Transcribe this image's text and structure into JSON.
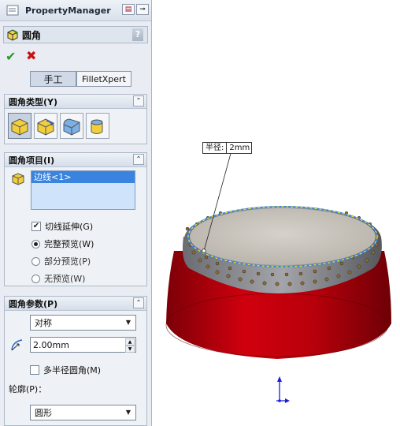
{
  "panel": {
    "title": "PropertyManager",
    "feature_title": "圆角",
    "help": "?",
    "mode_tabs": [
      "手工",
      "FilletXpert"
    ],
    "fillet_type": {
      "title": "圆角类型(Y)"
    },
    "fillet_items": {
      "title": "圆角项目(I)",
      "selected_item": "边线<1>",
      "tangent_propagation": "切线延伸(G)",
      "preview_options": [
        "完整预览(W)",
        "部分预览(P)",
        "无预览(W)"
      ]
    },
    "fillet_params": {
      "title": "圆角参数(P)",
      "method": "对称",
      "radius": "2.00mm",
      "multi_radius": "多半径圆角(M)",
      "profile_label": "轮廓(P)：",
      "profile": "圆形"
    }
  },
  "viewport": {
    "callout_label": "半径:",
    "callout_value": "2mm"
  },
  "colors": {
    "body_red": "#c4000b",
    "top_face": "#c8c4bc",
    "edge_highlight": "#f3e12a",
    "selection_blue": "#3a84e0"
  }
}
